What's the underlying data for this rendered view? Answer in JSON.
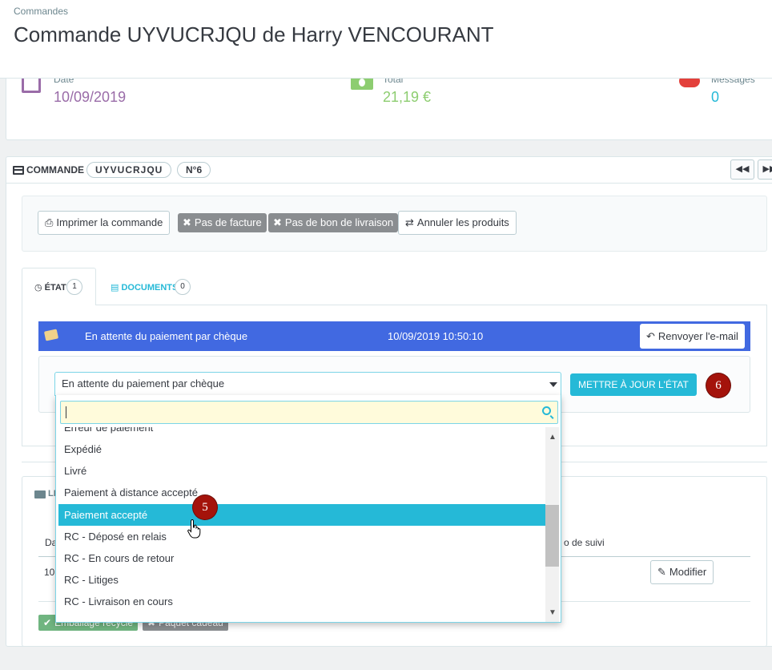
{
  "header": {
    "breadcrumb": "Commandes",
    "title": "Commande UYVUCRJQU de Harry VENCOURANT"
  },
  "kpis": {
    "date_label": "Date",
    "date_value": "10/09/2019",
    "total_label": "Total",
    "total_value": "21,19 €",
    "messages_label": "Messages",
    "messages_value": "0"
  },
  "order": {
    "heading": "COMMANDE",
    "reference": "UYVUCRJQU",
    "number": "N°6",
    "prev_icon": "double-left-arrow",
    "next_icon": "double-right-arrow"
  },
  "actions": {
    "print": "Imprimer la commande",
    "no_invoice": "Pas de facture",
    "no_delivery_slip": "Pas de bon de livraison",
    "cancel_products": "Annuler les produits"
  },
  "tabs": [
    {
      "label": "ÉTAT",
      "count": "1"
    },
    {
      "label": "DOCUMENTS",
      "count": "0"
    }
  ],
  "history": {
    "status": "En attente du paiement par chèque",
    "datetime": "10/09/2019 10:50:10",
    "resend": "Renvoyer l'e-mail",
    "status_color": "#4169e1"
  },
  "update": {
    "selected_value": "En attente du paiement par chèque",
    "search_value": "",
    "button": "METTRE À JOUR L'ÉTAT",
    "step6": "6",
    "step5": "5"
  },
  "dropdown": {
    "partial_top": "Erreur de paiement",
    "options": [
      "Expédié",
      "Livré",
      "Paiement à distance accepté",
      "Paiement accepté",
      "RC - Déposé en relais",
      "RC - En cours de retour",
      "RC - Litiges",
      "RC - Livraison en cours"
    ],
    "selected": "Paiement accepté"
  },
  "shipping": {
    "tab_label": "LI",
    "col_date": "Da",
    "col_tracking": "o de suivi",
    "row_date": "10",
    "modify": "Modifier",
    "recycled": "Emballage recyclé",
    "gift": "Paquet cadeau"
  },
  "colors": {
    "accent": "#25b9d7",
    "step_badge": "#a4130b",
    "kpi_date": "#9a6ca8",
    "kpi_total": "#8dcd70",
    "kpi_messages": "#25b9d7"
  }
}
